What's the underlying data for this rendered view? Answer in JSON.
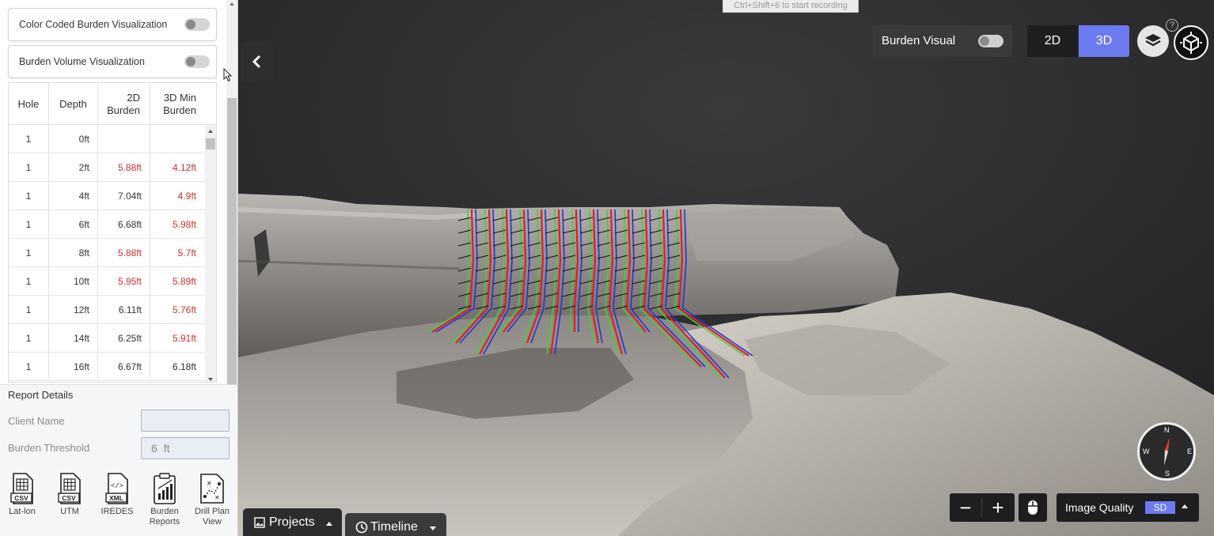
{
  "panel": {
    "toggles": [
      {
        "label": "Color Coded Burden Visualization",
        "on": false
      },
      {
        "label": "Burden Volume Visualization",
        "on": false
      }
    ],
    "table": {
      "headers": [
        {
          "line1": "Hole",
          "line2": ""
        },
        {
          "line1": "Depth",
          "line2": ""
        },
        {
          "line1": "2D",
          "line2": "Burden"
        },
        {
          "line1": "3D Min",
          "line2": "Burden"
        }
      ],
      "rows": [
        {
          "hole": "1",
          "depth": "0ft",
          "burden_2d": "",
          "burden_3d": "",
          "flag_2d": false,
          "flag_3d": false
        },
        {
          "hole": "1",
          "depth": "2ft",
          "burden_2d": "5.88ft",
          "burden_3d": "4.12ft",
          "flag_2d": true,
          "flag_3d": true
        },
        {
          "hole": "1",
          "depth": "4ft",
          "burden_2d": "7.04ft",
          "burden_3d": "4.9ft",
          "flag_2d": false,
          "flag_3d": true
        },
        {
          "hole": "1",
          "depth": "6ft",
          "burden_2d": "6.68ft",
          "burden_3d": "5.98ft",
          "flag_2d": false,
          "flag_3d": true
        },
        {
          "hole": "1",
          "depth": "8ft",
          "burden_2d": "5.88ft",
          "burden_3d": "5.7ft",
          "flag_2d": true,
          "flag_3d": true
        },
        {
          "hole": "1",
          "depth": "10ft",
          "burden_2d": "5.95ft",
          "burden_3d": "5.89ft",
          "flag_2d": true,
          "flag_3d": true
        },
        {
          "hole": "1",
          "depth": "12ft",
          "burden_2d": "6.11ft",
          "burden_3d": "5.76ft",
          "flag_2d": false,
          "flag_3d": true
        },
        {
          "hole": "1",
          "depth": "14ft",
          "burden_2d": "6.25ft",
          "burden_3d": "5.91ft",
          "flag_2d": false,
          "flag_3d": true
        },
        {
          "hole": "1",
          "depth": "16ft",
          "burden_2d": "6.67ft",
          "burden_3d": "6.18ft",
          "flag_2d": false,
          "flag_3d": false
        }
      ]
    },
    "report": {
      "title": "Report Details",
      "client_label": "Client Name",
      "client_value": "",
      "threshold_label": "Burden Threshold",
      "threshold_value": "6",
      "threshold_unit": "ft"
    },
    "exports": [
      {
        "icon": "csv-file-icon",
        "tag": "CSV",
        "line1": "Lat-lon",
        "line2": ""
      },
      {
        "icon": "csv-file-icon",
        "tag": "CSV",
        "line1": "UTM",
        "line2": ""
      },
      {
        "icon": "xml-file-icon",
        "tag": "XML",
        "line1": "IREDES",
        "line2": ""
      },
      {
        "icon": "report-chart-icon",
        "tag": "",
        "line1": "Burden",
        "line2": "Reports"
      },
      {
        "icon": "drill-plan-icon",
        "tag": "",
        "line1": "Drill Plan",
        "line2": "View"
      }
    ]
  },
  "viewport": {
    "record_hint": "Ctrl+Shift+6 to start recording",
    "burden_visual_label": "Burden Visual",
    "burden_visual_on": false,
    "view_modes": [
      "2D",
      "3D"
    ],
    "active_view_mode": "3D",
    "compass": {
      "n": "N",
      "s": "S",
      "e": "E",
      "w": "W"
    },
    "zoom_out": "−",
    "zoom_in": "+",
    "image_quality_label": "Image Quality",
    "image_quality_value": "SD",
    "tabs": [
      {
        "label": "Projects",
        "icon": "image-icon"
      },
      {
        "label": "Timeline",
        "icon": "clock-icon"
      }
    ]
  },
  "colors": {
    "accent": "#6c7bf0",
    "flag": "#d0312d",
    "hole_green": "#3fd13a",
    "hole_red": "#e21f1f",
    "hole_blue": "#2233dd"
  }
}
